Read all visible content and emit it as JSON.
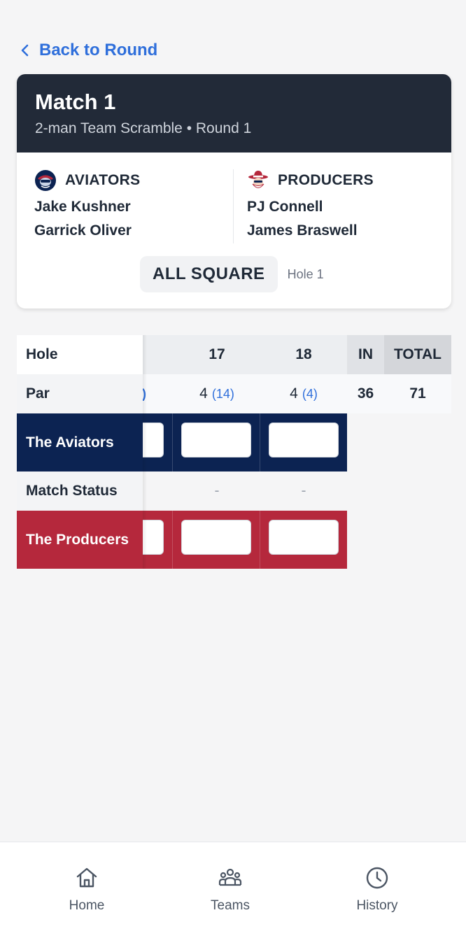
{
  "nav": {
    "back_label": "Back to Round"
  },
  "match": {
    "title": "Match 1",
    "subtitle": "2-man Team Scramble • Round 1",
    "status": "ALL SQUARE",
    "hole": "Hole 1",
    "teams": [
      {
        "name": "AVIATORS",
        "players": [
          "Jake Kushner",
          "Garrick Oliver"
        ],
        "color": "#0c2352"
      },
      {
        "name": "PRODUCERS",
        "players": [
          "PJ Connell",
          "James Braswell"
        ],
        "color": "#b5283c"
      }
    ]
  },
  "scorecard": {
    "row_labels": {
      "hole": "Hole",
      "par": "Par",
      "aviators": "The Aviators",
      "status": "Match Status",
      "producers": "The Producers"
    },
    "holes": [
      {
        "number": "17",
        "par": "4",
        "hcp": "(14)",
        "status": "-"
      },
      {
        "number": "18",
        "par": "4",
        "hcp": "(4)",
        "status": "-"
      }
    ],
    "partial_hcp": ")",
    "in": {
      "label": "IN",
      "par": "36"
    },
    "total": {
      "label": "TOTAL",
      "par": "71"
    }
  },
  "bottom_nav": [
    {
      "label": "Home",
      "icon": "home-icon"
    },
    {
      "label": "Teams",
      "icon": "teams-icon"
    },
    {
      "label": "History",
      "icon": "history-icon"
    }
  ],
  "colors": {
    "accent": "#2f6fdb",
    "header": "#222a38",
    "aviators": "#0c2352",
    "producers": "#b5283c"
  }
}
